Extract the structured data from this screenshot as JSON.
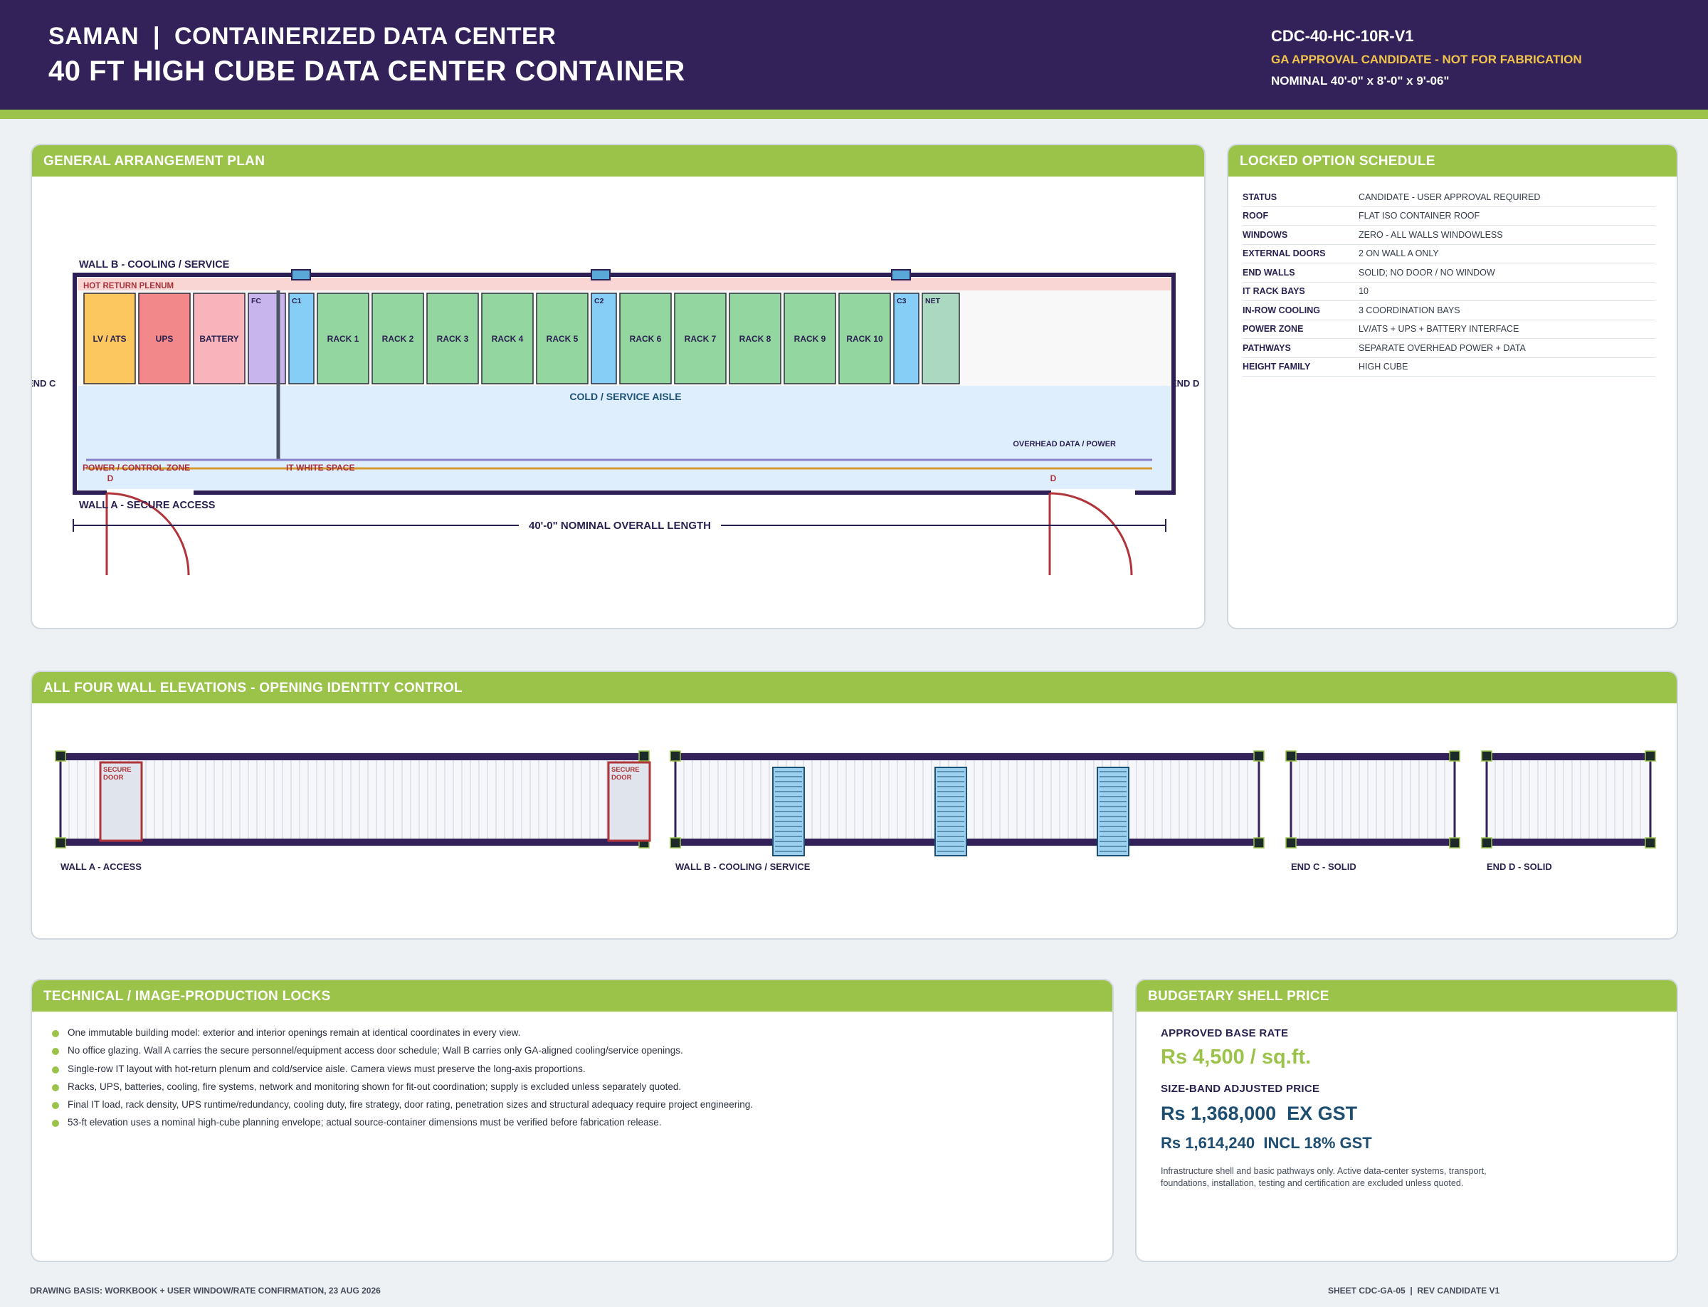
{
  "header": {
    "line1": "SAMAN  |  CONTAINERIZED DATA CENTER",
    "line2": "40 FT HIGH CUBE DATA CENTER CONTAINER",
    "code": "CDC-40-HC-10R-V1",
    "status": "GA APPROVAL CANDIDATE - NOT FOR FABRICATION",
    "dims": "NOMINAL 40'-0\" x 8'-0\" x 9'-06\""
  },
  "plan": {
    "title": "GENERAL ARRANGEMENT PLAN",
    "wall_b_label": "WALL B - COOLING / SERVICE",
    "wall_a_label": "WALL A - SECURE ACCESS",
    "end_c_label": "END C",
    "end_d_label": "END D",
    "hot_plenum_label": "HOT RETURN PLENUM",
    "cold_aisle_label": "COLD / SERVICE AISLE",
    "overhead_label": "OVERHEAD DATA / POWER",
    "power_zone_label": "POWER / CONTROL ZONE",
    "white_space_label": "IT WHITE SPACE",
    "door_marker_1": "D",
    "door_marker_2": "D",
    "length_label": "40'-0\" NOMINAL OVERALL LENGTH",
    "equipment": [
      {
        "label": "LV / ATS",
        "color": "#fdc760"
      },
      {
        "label": "UPS",
        "color": "#f2888a"
      },
      {
        "label": "BATTERY",
        "color": "#f8b4ba"
      },
      {
        "label": "FC",
        "color": "#c9b5ee"
      },
      {
        "label": "C1",
        "color": "#86cef5"
      },
      {
        "label": "RACK 1",
        "color": "#94d6a0"
      },
      {
        "label": "RACK 2",
        "color": "#94d6a0"
      },
      {
        "label": "RACK 3",
        "color": "#94d6a0"
      },
      {
        "label": "RACK 4",
        "color": "#94d6a0"
      },
      {
        "label": "RACK 5",
        "color": "#94d6a0"
      },
      {
        "label": "C2",
        "color": "#86cef5"
      },
      {
        "label": "RACK 6",
        "color": "#94d6a0"
      },
      {
        "label": "RACK 7",
        "color": "#94d6a0"
      },
      {
        "label": "RACK 8",
        "color": "#94d6a0"
      },
      {
        "label": "RACK 9",
        "color": "#94d6a0"
      },
      {
        "label": "RACK 10",
        "color": "#94d6a0"
      },
      {
        "label": "C3",
        "color": "#86cef5"
      },
      {
        "label": "NET",
        "color": "#abd8c0"
      }
    ]
  },
  "schedule": {
    "title": "LOCKED OPTION SCHEDULE",
    "rows": [
      {
        "key": "STATUS",
        "value": "CANDIDATE - USER APPROVAL REQUIRED"
      },
      {
        "key": "ROOF",
        "value": "FLAT ISO CONTAINER ROOF"
      },
      {
        "key": "WINDOWS",
        "value": "ZERO - ALL WALLS WINDOWLESS"
      },
      {
        "key": "EXTERNAL DOORS",
        "value": "2 ON WALL A ONLY"
      },
      {
        "key": "END WALLS",
        "value": "SOLID; NO DOOR / NO WINDOW"
      },
      {
        "key": "IT RACK BAYS",
        "value": "10"
      },
      {
        "key": "IN-ROW COOLING",
        "value": "3 COORDINATION BAYS"
      },
      {
        "key": "POWER ZONE",
        "value": "LV/ATS + UPS + BATTERY INTERFACE"
      },
      {
        "key": "PATHWAYS",
        "value": "SEPARATE OVERHEAD POWER + DATA"
      },
      {
        "key": "HEIGHT FAMILY",
        "value": "HIGH CUBE"
      }
    ]
  },
  "elevations": {
    "title": "ALL FOUR WALL ELEVATIONS - OPENING IDENTITY CONTROL",
    "wall_a": "WALL A - ACCESS",
    "wall_b": "WALL B - COOLING / SERVICE",
    "end_c": "END C - SOLID",
    "end_d": "END D - SOLID",
    "door_label_line1": "SECURE",
    "door_label_line2": "DOOR"
  },
  "locks": {
    "title": "TECHNICAL / IMAGE-PRODUCTION LOCKS",
    "items": [
      "One immutable building model: exterior and interior openings remain at identical coordinates in every view.",
      "No office glazing. Wall A carries the secure personnel/equipment access door schedule; Wall B carries only GA-aligned cooling/service openings.",
      "Single-row IT layout with hot-return plenum and cold/service aisle. Camera views must preserve the long-axis proportions.",
      "Racks, UPS, batteries, cooling, fire systems, network and monitoring shown for fit-out coordination; supply is excluded unless separately quoted.",
      "Final IT load, rack density, UPS runtime/redundancy, cooling duty, fire strategy, door rating, penetration sizes and structural adequacy require project engineering.",
      "53-ft elevation uses a nominal high-cube planning envelope; actual source-container dimensions must be verified before fabrication release."
    ]
  },
  "price": {
    "title": "BUDGETARY SHELL PRICE",
    "base_label": "APPROVED BASE RATE",
    "base_value": "Rs 4,500 / sq.ft.",
    "adjusted_label": "SIZE-BAND ADJUSTED PRICE",
    "ex_gst": "Rs 1,368,000  EX GST",
    "incl_gst": "Rs 1,614,240  INCL 18% GST",
    "note": "Infrastructure shell and basic pathways only. Active data-center systems, transport, foundations, installation, testing and certification are excluded unless quoted."
  },
  "footer": {
    "left": "DRAWING BASIS: WORKBOOK + USER WINDOW/RATE CONFIRMATION, 23 AUG 2026",
    "right": "SHEET CDC-GA-05  |  REV CANDIDATE V1"
  },
  "colors": {
    "header_bg": "#33225a",
    "accent_green": "#9bc34a",
    "container_frame": "#2d1f55",
    "door_red": "#b0343a",
    "price_green": "#9bc34a",
    "price_blue": "#1d4e72"
  }
}
